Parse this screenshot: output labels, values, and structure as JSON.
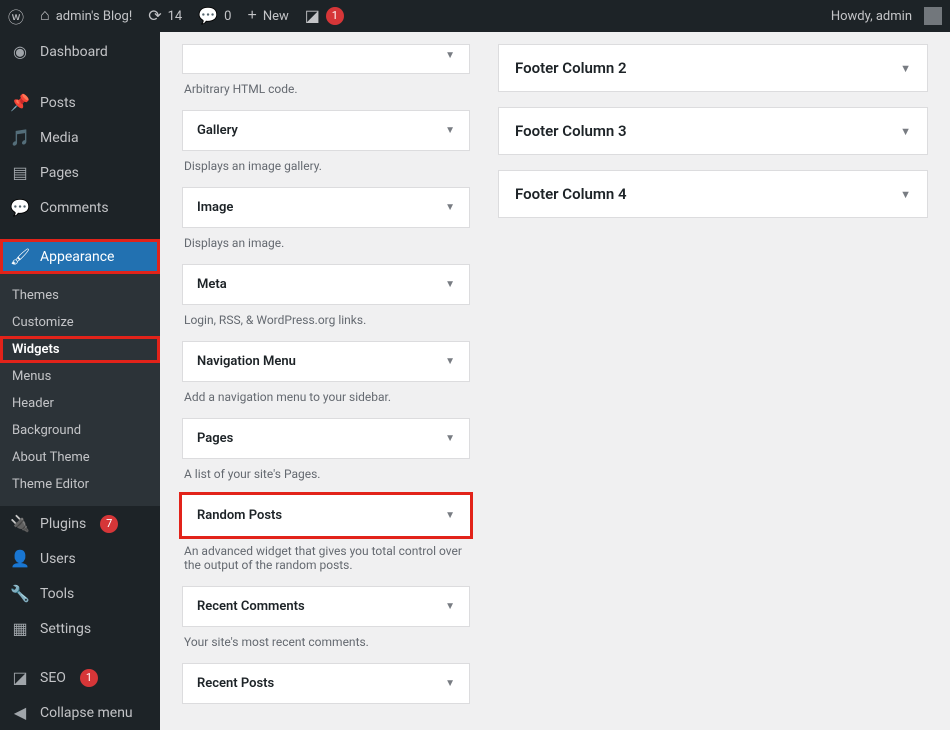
{
  "toolbar": {
    "site_name": "admin's Blog!",
    "updates": "14",
    "comments": "0",
    "new_label": "New",
    "notif": "1",
    "howdy": "Howdy, admin"
  },
  "menu": {
    "dashboard": "Dashboard",
    "posts": "Posts",
    "media": "Media",
    "pages": "Pages",
    "comments": "Comments",
    "appearance": "Appearance",
    "plugins": "Plugins",
    "plugins_count": "7",
    "users": "Users",
    "tools": "Tools",
    "settings": "Settings",
    "seo": "SEO",
    "seo_count": "1",
    "collapse": "Collapse menu"
  },
  "submenu": {
    "themes": "Themes",
    "customize": "Customize",
    "widgets": "Widgets",
    "menus": "Menus",
    "header": "Header",
    "background": "Background",
    "about": "About Theme",
    "editor": "Theme Editor"
  },
  "widgets": [
    {
      "title": "",
      "desc": "Arbitrary HTML code."
    },
    {
      "title": "Gallery",
      "desc": "Displays an image gallery."
    },
    {
      "title": "Image",
      "desc": "Displays an image."
    },
    {
      "title": "Meta",
      "desc": "Login, RSS, & WordPress.org links."
    },
    {
      "title": "Navigation Menu",
      "desc": "Add a navigation menu to your sidebar."
    },
    {
      "title": "Pages",
      "desc": "A list of your site's Pages."
    },
    {
      "title": "Random Posts",
      "desc": "An advanced widget that gives you total control over the output of the random posts."
    },
    {
      "title": "Recent Comments",
      "desc": "Your site's most recent comments."
    },
    {
      "title": "Recent Posts",
      "desc": ""
    }
  ],
  "areas": [
    {
      "title": "Footer Column 2"
    },
    {
      "title": "Footer Column 3"
    },
    {
      "title": "Footer Column 4"
    }
  ]
}
